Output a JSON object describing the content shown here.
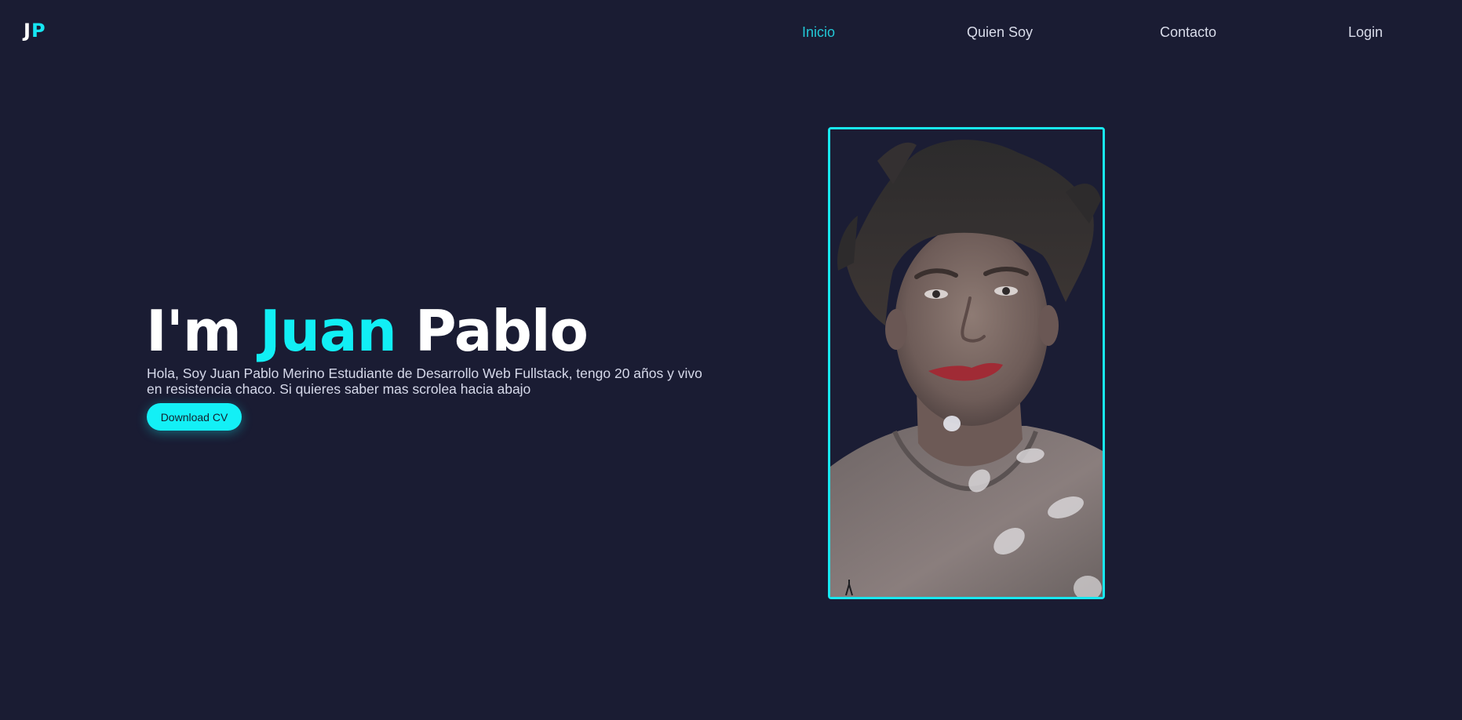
{
  "header": {
    "logo": {
      "first": "J",
      "second": "P"
    },
    "nav": [
      {
        "label": "Inicio",
        "active": true
      },
      {
        "label": "Quien Soy",
        "active": false
      },
      {
        "label": "Contacto",
        "active": false
      },
      {
        "label": "Login",
        "active": false
      }
    ]
  },
  "hero": {
    "title_prefix": "I'm",
    "title_accent": "Juan",
    "title_suffix": "Pablo",
    "description": "Hola, Soy Juan Pablo Merino Estudiante de Desarrollo Web Fullstack, tengo 20 años y vivo en resistencia chaco. Si quieres saber mas scrolea hacia abajo",
    "cv_button": "Download CV"
  },
  "photo": {
    "subject": "portrait-photo"
  },
  "colors": {
    "background": "#1a1c33",
    "accent": "#13f0f6",
    "nav_active": "#22c7d6",
    "text": "#d9dcea"
  }
}
